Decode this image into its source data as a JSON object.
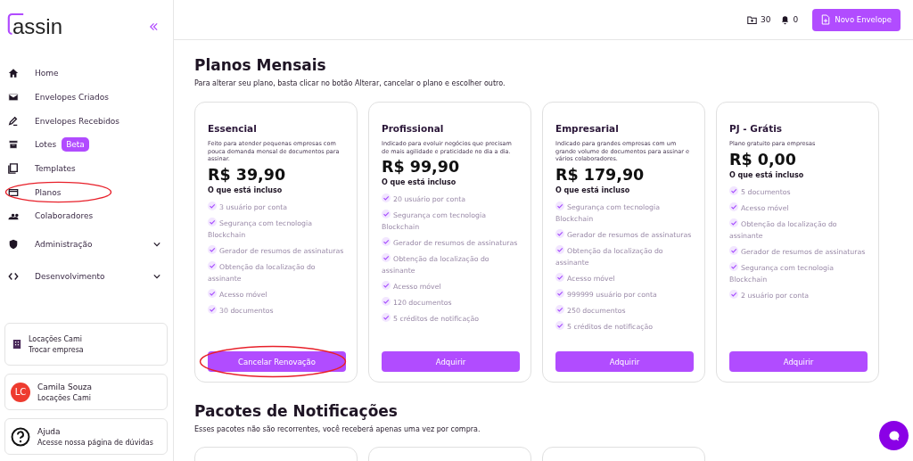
{
  "sidebar": {
    "logo": "assin",
    "nav": [
      {
        "label": "Home",
        "circled": false,
        "expandable": false
      },
      {
        "label": "Envelopes Criados",
        "circled": false,
        "expandable": false
      },
      {
        "label": "Envelopes Recebidos",
        "circled": false,
        "expandable": false
      },
      {
        "label": "Lotes",
        "badge": "Beta",
        "circled": false,
        "expandable": false
      },
      {
        "label": "Templates",
        "circled": false,
        "expandable": false
      },
      {
        "label": "Planos",
        "circled": true,
        "expandable": false
      },
      {
        "label": "Colaboradores",
        "circled": false,
        "expandable": false
      },
      {
        "label": "Administração",
        "circled": false,
        "expandable": true
      },
      {
        "label": "Desenvolvimento",
        "circled": false,
        "expandable": true
      }
    ],
    "company": {
      "name": "Locações Cami",
      "action": "Trocar empresa"
    },
    "user": {
      "initials": "LC",
      "name": "Camila Souza",
      "company": "Locações Cami"
    },
    "help": {
      "title": "Ajuda",
      "subtitle": "Acesse nossa página de dúvidas"
    }
  },
  "header": {
    "envelopes_count": "30",
    "notifications_count": "0",
    "new_button": "Novo Envelope"
  },
  "plans_section": {
    "title": "Planos Mensais",
    "subtitle": "Para alterar seu plano, basta clicar no botão Alterar, cancelar o plano e escolher outro.",
    "plans": [
      {
        "name": "Essencial",
        "description": "Feito para atender pequenas empresas com pouca demanda mensal de documentos para assinar.",
        "price": "R$ 39,90",
        "included_label": "O que está incluso",
        "features": [
          "3 usuário por conta",
          "Segurança com tecnologia Blockchain",
          "Gerador de resumos de assinaturas",
          "Obtenção da localização do assinante",
          "Acesso móvel",
          "30 documentos"
        ],
        "button": "Cancelar Renovação",
        "button_circled": true
      },
      {
        "name": "Profissional",
        "description": "Indicado para evoluir negócios que precisam de mais agilidade e praticidade no dia a dia.",
        "price": "R$ 99,90",
        "included_label": "O que está incluso",
        "features": [
          "20 usuário por conta",
          "Segurança com tecnologia Blockchain",
          "Gerador de resumos de assinaturas",
          "Obtenção da localização do assinante",
          "Acesso móvel",
          "120 documentos",
          "5 créditos de notificação"
        ],
        "button": "Adquirir",
        "button_circled": false
      },
      {
        "name": "Empresarial",
        "description": "Indicado para grandes empresas com um grande volume de documentos para assinar e vários colaboradores.",
        "price": "R$ 179,90",
        "included_label": "O que está incluso",
        "features": [
          "Segurança com tecnologia Blockchain",
          "Gerador de resumos de assinaturas",
          "Obtenção da localização do assinante",
          "Acesso móvel",
          "999999 usuário por conta",
          "250 documentos",
          "5 créditos de notificação"
        ],
        "button": "Adquirir",
        "button_circled": false
      },
      {
        "name": "PJ - Grátis",
        "description": "Plano gratuito para empresas",
        "price": "R$ 0,00",
        "included_label": "O que está incluso",
        "features": [
          "5 documentos",
          "Acesso móvel",
          "Obtenção da localização do assinante",
          "Gerador de resumos de assinaturas",
          "Segurança com tecnologia Blockchain",
          "2 usuário por conta"
        ],
        "button": "Adquirir",
        "button_circled": false
      }
    ]
  },
  "packages_section": {
    "title": "Pacotes de Notificações",
    "subtitle": "Esses pacotes não são recorrentes, você receberá apenas uma vez por compra."
  }
}
